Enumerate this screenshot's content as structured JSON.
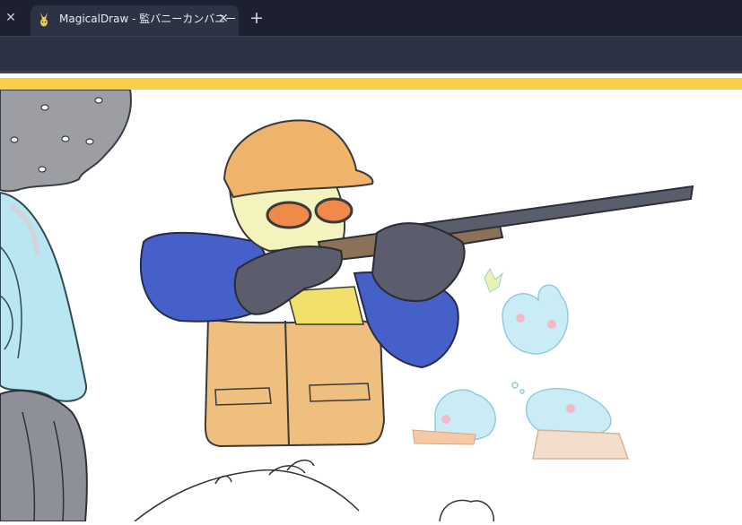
{
  "browser": {
    "tabs": [
      {
        "title": "MagicalDraw - 監バニーカンバニー",
        "active": true,
        "favicon": "rabbit-icon"
      }
    ],
    "icons": {
      "close": "close-icon",
      "new_tab": "plus-icon"
    },
    "glyphs": {
      "close": "✕",
      "plus": "+"
    }
  },
  "colors": {
    "tabstrip": "#1c2031",
    "tab_active": "#2d3345",
    "accent": "#f7cf4a",
    "canvas": "#ffffff"
  }
}
